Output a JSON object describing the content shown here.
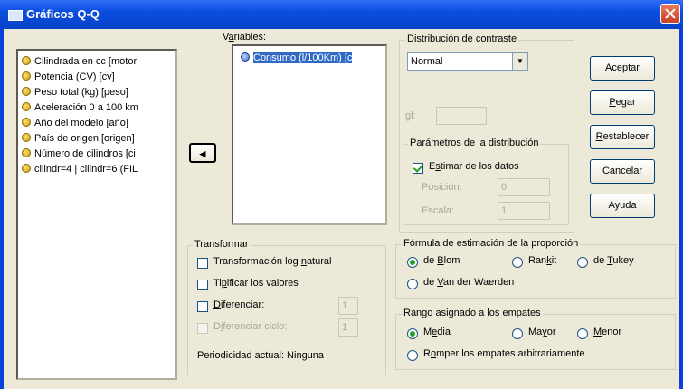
{
  "window": {
    "title": "Gráficos Q-Q"
  },
  "source_list": {
    "items": [
      "Cilindrada en cc [motor",
      "Potencia (CV) [cv]",
      "Peso total (kg) [peso]",
      "Aceleración 0 a 100 km",
      "Año del modelo [año]",
      "País de origen [origen]",
      "Número de cilindros [ci",
      "cilindr=4 | cilindr=6 (FIL"
    ]
  },
  "transfer_button": {
    "label": "◂"
  },
  "variables": {
    "label_prefix": "V",
    "label_underlined": "a",
    "label_suffix": "riables:",
    "items": [
      "Consumo (l/100Km) [c"
    ]
  },
  "distribution": {
    "group_label": "Distribución de contraste",
    "select_value": "Normal",
    "df_label": "gl:",
    "df_value": ""
  },
  "params": {
    "group_label": "Parámetros de la distribución",
    "estimate_prefix": "E",
    "estimate_underlined": "s",
    "estimate_suffix": "timar de los datos",
    "estimate_checked": true,
    "position_label": "Posición:",
    "position_value": "0",
    "scale_label": "Escala:",
    "scale_value": "1"
  },
  "buttons": {
    "ok": "Aceptar",
    "paste_u": "P",
    "paste_rest": "egar",
    "reset_u": "R",
    "reset_rest": "establecer",
    "cancel": "Cancelar",
    "help": "Ayuda"
  },
  "transform": {
    "group_label": "Transformar",
    "log_prefix": "Transformación log ",
    "log_u": "n",
    "log_suffix": "atural",
    "std_prefix": "Ti",
    "std_u": "p",
    "std_suffix": "ificar los valores",
    "diff_u": "D",
    "diff_suffix": "iferenciar:",
    "diff_value": "1",
    "sdiff_prefix": "D",
    "sdiff_u": "i",
    "sdiff_suffix": "ferenciar ciclo:",
    "sdiff_value": "1",
    "periodicity": "Periodicidad actual: Ninguna"
  },
  "formula": {
    "group_label": "Fórmula de estimación de la proporción",
    "blom_prefix": "de ",
    "blom_u": "B",
    "blom_suffix": "lom",
    "blom_selected": true,
    "rankit_prefix": "Ran",
    "rankit_u": "k",
    "rankit_suffix": "it",
    "tukey_prefix": "de ",
    "tukey_u": "T",
    "tukey_suffix": "ukey",
    "vdw_prefix": "de ",
    "vdw_u": "V",
    "vdw_suffix": "an der Waerden"
  },
  "ties": {
    "group_label": "Rango asignado a los empates",
    "mean_prefix": "M",
    "mean_u": "e",
    "mean_suffix": "dia",
    "mean_selected": true,
    "max_prefix": "Ma",
    "max_u": "y",
    "max_suffix": "or",
    "min_u": "M",
    "min_suffix": "enor",
    "break_prefix": "R",
    "break_u": "o",
    "break_suffix": "mper los empates arbitrariamente"
  }
}
